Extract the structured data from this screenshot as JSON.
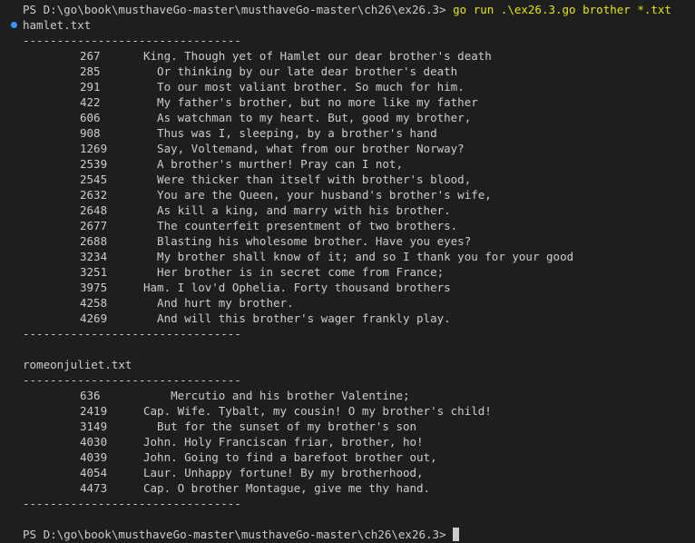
{
  "terminal": {
    "prompt": "PS D:\\go\\book\\musthaveGo-master\\musthaveGo-master\\ch26\\ex26.3>",
    "command": "go run .\\ex26.3.go brother *.txt",
    "separator": "--------------------------------",
    "final_prompt": "PS D:\\go\\book\\musthaveGo-master\\musthaveGo-master\\ch26\\ex26.3>"
  },
  "files": [
    {
      "name": "hamlet.txt",
      "results": [
        {
          "line": "267",
          "text": "King. Though yet of Hamlet our dear brother's death"
        },
        {
          "line": "285",
          "text": "  Or thinking by our late dear brother's death"
        },
        {
          "line": "291",
          "text": "  To our most valiant brother. So much for him."
        },
        {
          "line": "422",
          "text": "  My father's brother, but no more like my father"
        },
        {
          "line": "606",
          "text": "  As watchman to my heart. But, good my brother,"
        },
        {
          "line": "908",
          "text": "  Thus was I, sleeping, by a brother's hand"
        },
        {
          "line": "1269",
          "text": "  Say, Voltemand, what from our brother Norway?"
        },
        {
          "line": "2539",
          "text": "  A brother's murther! Pray can I not,"
        },
        {
          "line": "2545",
          "text": "  Were thicker than itself with brother's blood,"
        },
        {
          "line": "2632",
          "text": "  You are the Queen, your husband's brother's wife,"
        },
        {
          "line": "2648",
          "text": "  As kill a king, and marry with his brother."
        },
        {
          "line": "2677",
          "text": "  The counterfeit presentment of two brothers."
        },
        {
          "line": "2688",
          "text": "  Blasting his wholesome brother. Have you eyes?"
        },
        {
          "line": "3234",
          "text": "  My brother shall know of it; and so I thank you for your good"
        },
        {
          "line": "3251",
          "text": "  Her brother is in secret come from France;"
        },
        {
          "line": "3975",
          "text": "Ham. I lov'd Ophelia. Forty thousand brothers"
        },
        {
          "line": "4258",
          "text": "  And hurt my brother."
        },
        {
          "line": "4269",
          "text": "  And will this brother's wager frankly play."
        }
      ]
    },
    {
      "name": "romeonjuliet.txt",
      "results": [
        {
          "line": "636",
          "text": "    Mercutio and his brother Valentine;"
        },
        {
          "line": "2419",
          "text": "Cap. Wife. Tybalt, my cousin! O my brother's child!"
        },
        {
          "line": "3149",
          "text": "  But for the sunset of my brother's son"
        },
        {
          "line": "4030",
          "text": "John. Holy Franciscan friar, brother, ho!"
        },
        {
          "line": "4039",
          "text": "John. Going to find a barefoot brother out,"
        },
        {
          "line": "4054",
          "text": "Laur. Unhappy fortune! By my brotherhood,"
        },
        {
          "line": "4473",
          "text": "Cap. O brother Montague, give me thy hand."
        }
      ]
    }
  ]
}
